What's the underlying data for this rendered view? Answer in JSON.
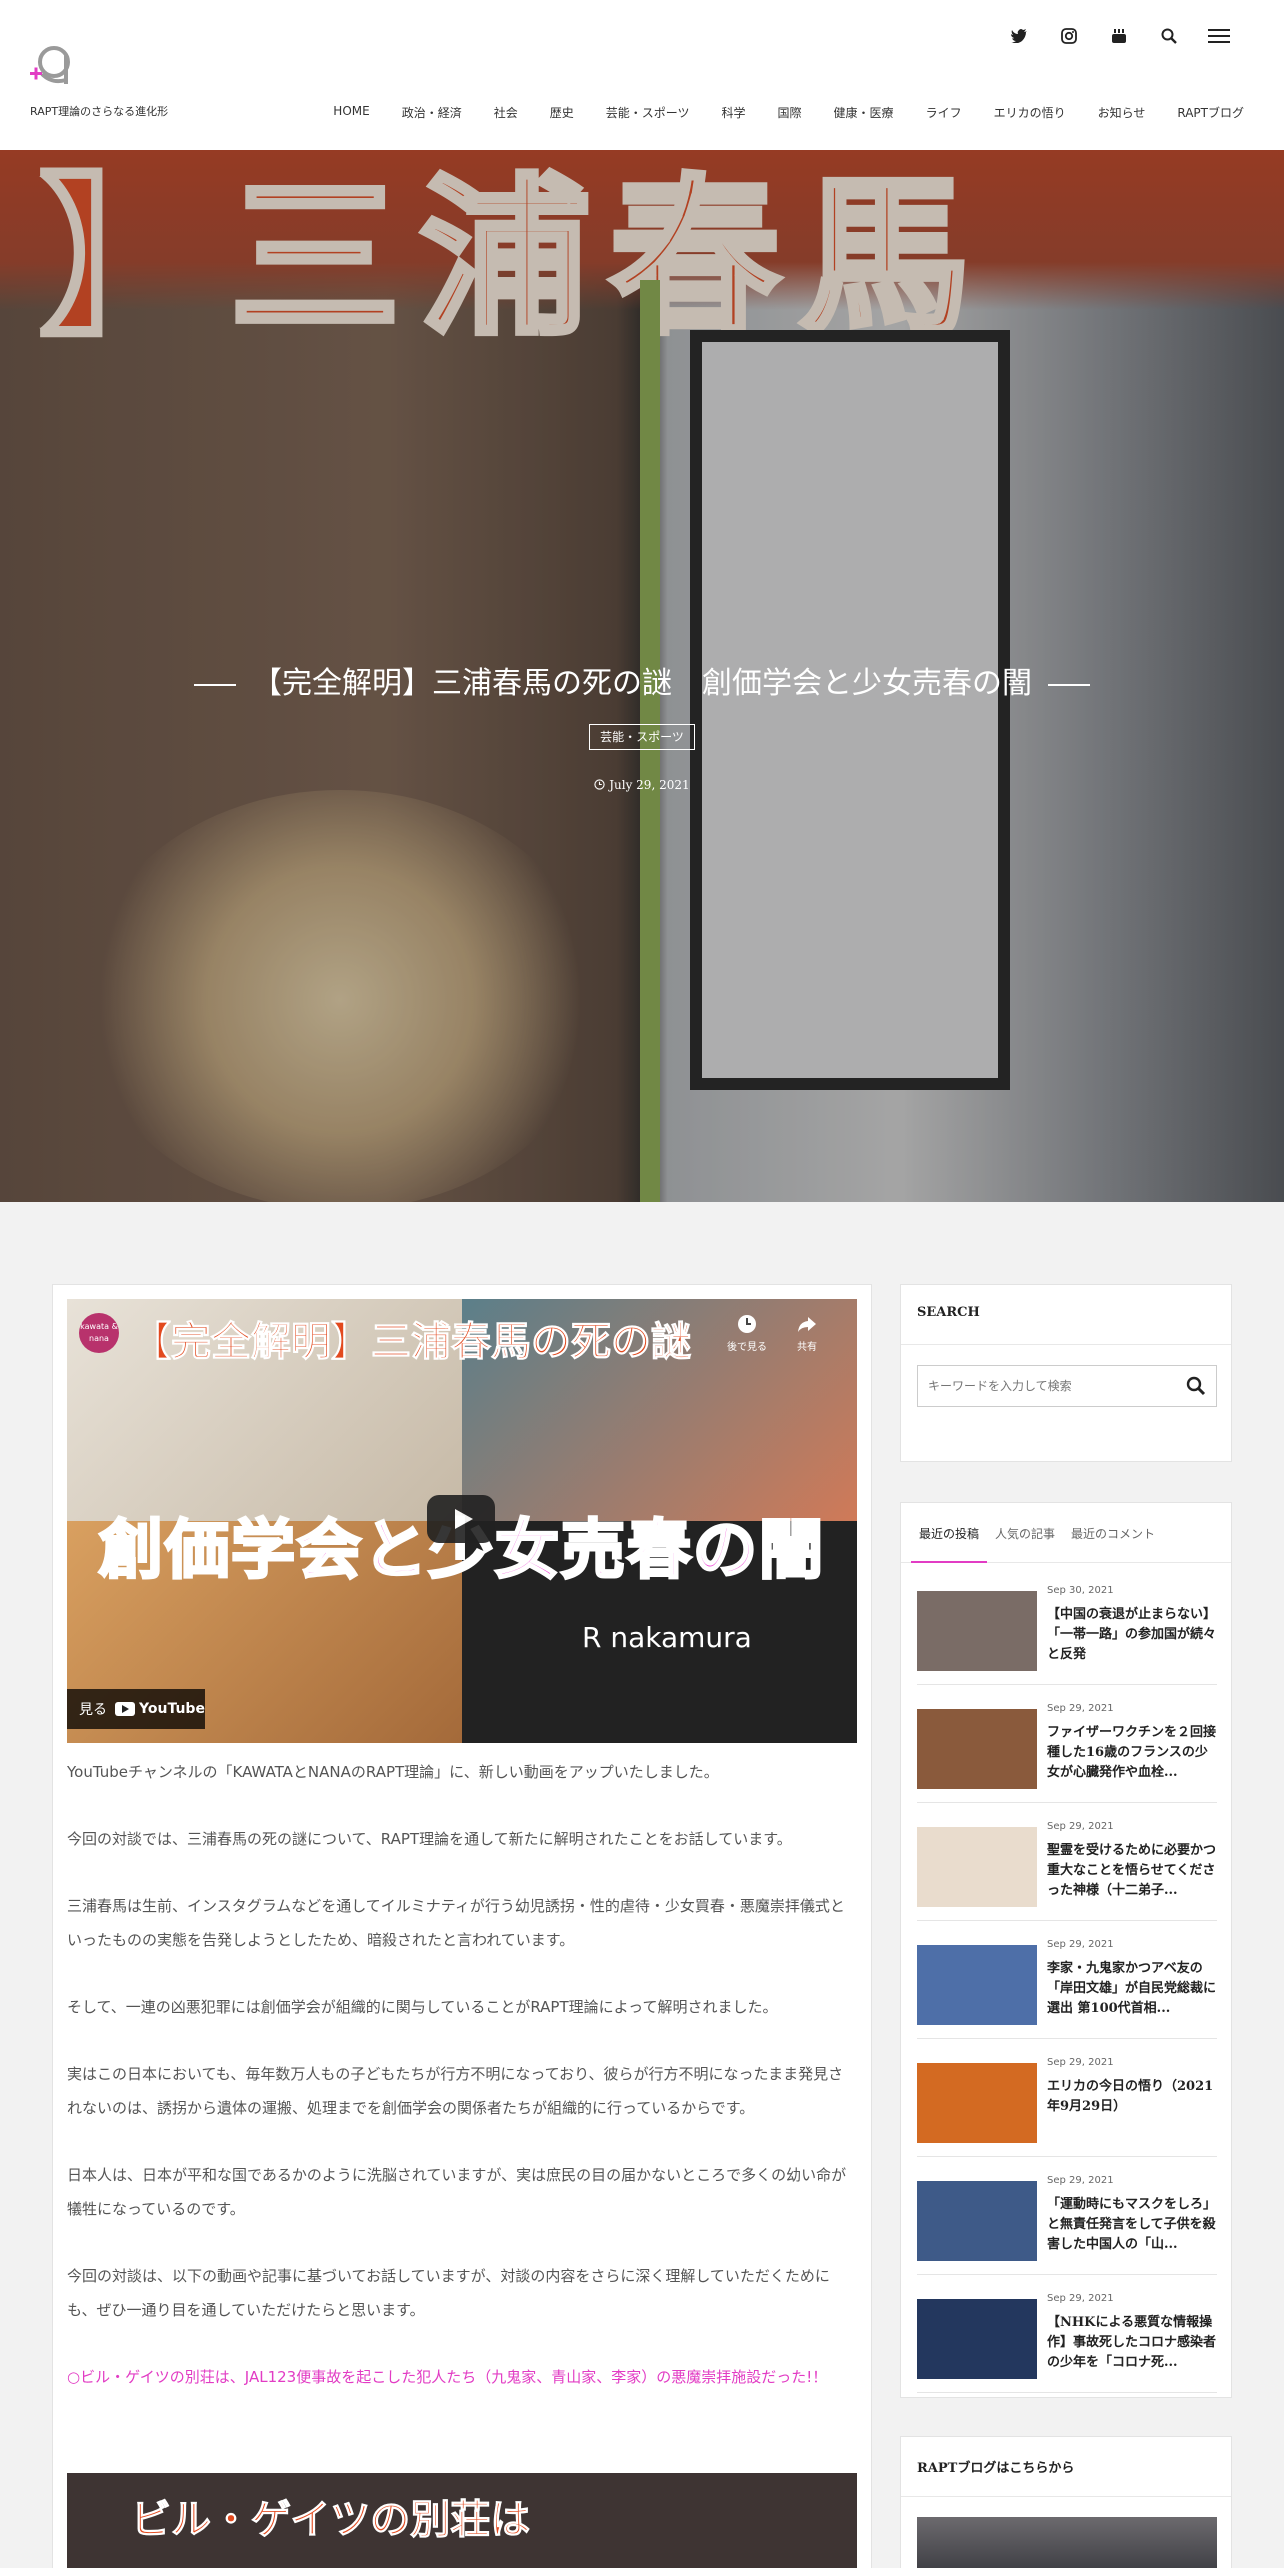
{
  "header": {
    "site_subtitle": "RAPT理論のさらなる進化形",
    "social_icons": [
      "twitter-icon",
      "instagram-icon",
      "youtube-icon",
      "search-icon",
      "menu-icon"
    ],
    "nav": [
      "HOME",
      "政治・経済",
      "社会",
      "歴史",
      "芸能・スポーツ",
      "科学",
      "国際",
      "健康・医療",
      "ライフ",
      "エリカの悟り",
      "お知らせ",
      "RAPTブログ"
    ]
  },
  "hero": {
    "banner_text": "】三浦春馬",
    "title": "【完全解明】三浦春馬の死の謎　創価学会と少女売春の闇",
    "category": "芸能・スポーツ",
    "date": "July 29, 2021"
  },
  "video": {
    "title": "【完全解明】三浦春馬の死の謎",
    "overlay_text": "創価学会と少女売春の闇",
    "name": "R nakamura",
    "avatar_text": "kawata & nana",
    "watch_later": "後で見る",
    "share": "共有",
    "watch_on": "見る",
    "yt_label": "YouTube"
  },
  "article": {
    "paragraphs": [
      "YouTubeチャンネルの「KAWATAとNANAのRAPT理論」に、新しい動画をアップいたしました。",
      "今回の対談では、三浦春馬の死の謎について、RAPT理論を通して新たに解明されたことをお話しています。",
      "三浦春馬は生前、インスタグラムなどを通してイルミナティが行う幼児誘拐・性的虐待・少女買春・悪魔崇拝儀式といったものの実態を告発しようとしたため、暗殺されたと言われています。",
      "そして、一連の凶悪犯罪には創価学会が組織的に関与していることがRAPT理論によって解明されました。",
      "実はこの日本においても、毎年数万人もの子どもたちが行方不明になっており、彼らが行方不明になったまま発見されないのは、誘拐から遺体の運搬、処理までを創価学会の関係者たちが組織的に行っているからです。",
      "日本人は、日本が平和な国であるかのように洗脳されていますが、実は庶民の目の届かないところで多くの幼い命が犠牲になっているのです。",
      "今回の対談は、以下の動画や記事に基づいてお話していますが、対談の内容をさらに深く理解していただくためにも、ぜひ一通り目を通していただけたらと思います。"
    ],
    "link": "○ビル・ゲイツの別荘は、JAL123便事故を起こした犯人たち（九鬼家、青山家、李家）の悪魔崇拝施設だった!！"
  },
  "video2": {
    "title": "ビル・ゲイツの別荘は"
  },
  "sidebar": {
    "search_title": "SEARCH",
    "search_placeholder": "キーワードを入力して検索",
    "tabs": [
      "最近の投稿",
      "人気の記事",
      "最近のコメント"
    ],
    "posts": [
      {
        "date": "Sep 30, 2021",
        "title": "【中国の衰退が止まらない】「一帯一路」の参加国が続々と反発",
        "color": "#7a6c66"
      },
      {
        "date": "Sep 29, 2021",
        "title": "ファイザーワクチンを２回接種した16歳のフランスの少女が心臓発作や血栓...",
        "color": "#8a5a3c"
      },
      {
        "date": "Sep 29, 2021",
        "title": "聖霊を受けるために必要かつ重大なことを悟らせてくださった神様（十二弟子...",
        "color": "#e9dccd"
      },
      {
        "date": "Sep 29, 2021",
        "title": "李家・九鬼家かつアベ友の「岸田文雄」が自民党総裁に選出 第100代首相...",
        "color": "#4e6fa8"
      },
      {
        "date": "Sep 29, 2021",
        "title": "エリカの今日の悟り（2021年9月29日）",
        "color": "#d36a22"
      },
      {
        "date": "Sep 29, 2021",
        "title": "「運動時にもマスクをしろ」と無責任発言をして子供を殺害した中国人の「山...",
        "color": "#3e5a88"
      },
      {
        "date": "Sep 29, 2021",
        "title": "【NHKによる悪質な情報操作】事故死したコロナ感染者の少年を「コロナ死...",
        "color": "#23375e"
      }
    ],
    "blog_title": "RAPTブログはこちらから"
  }
}
